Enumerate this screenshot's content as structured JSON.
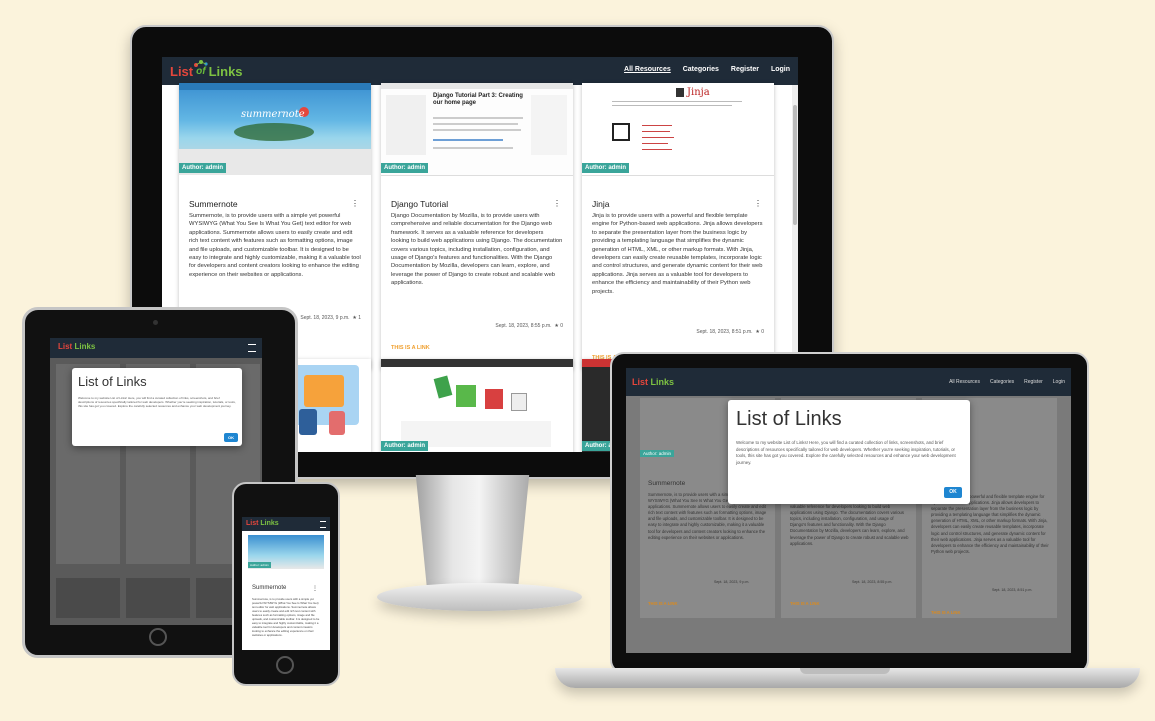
{
  "app": {
    "logo": {
      "list": "List",
      "of": "of",
      "links": "Links"
    },
    "nav": [
      "All Resources",
      "Categories",
      "Register",
      "Login"
    ]
  },
  "cards": [
    {
      "title": "Summernote",
      "badge": "Author: admin",
      "thumb_caption": "summernote",
      "description": "Summernote, is to provide users with a simple yet powerful WYSIWYG (What You See Is What You Get) text editor for web applications. Summernote allows users to easily create and edit rich text content with features such as formatting options, image and file uploads, and customizable toolbar. It is designed to be easy to integrate and highly customizable, making it a valuable tool for developers and content creators looking to enhance the editing experience on their websites or applications.",
      "date": "Sept. 18, 2023, 9 p.m.",
      "likes": "1",
      "link": ""
    },
    {
      "title": "Django Tutorial",
      "badge": "Author: admin",
      "thumb_caption": "Django Tutorial Part 3: Creating our home page",
      "description": "Django Documentation by Mozilla, is to provide users with comprehensive and reliable documentation for the Django web framework. It serves as a valuable reference for developers looking to build web applications using Django. The documentation covers various topics, including installation, configuration, and usage of Django's features and functionalities. With the Django Documentation by Mozilla, developers can learn, explore, and leverage the power of Django to create robust and scalable web applications.",
      "date": "Sept. 18, 2023, 8:55 p.m.",
      "likes": "0",
      "link": "THIS IS A LINK"
    },
    {
      "title": "Jinja",
      "badge": "Author: admin",
      "thumb_caption": "Jinja",
      "description": "Jinja is to provide users with a powerful and flexible template engine for Python-based web applications. Jinja allows developers to separate the presentation layer from the business logic by providing a templating language that simplifies the dynamic generation of HTML, XML, or other markup formats. With Jinja, developers can easily create reusable templates, incorporate logic and control structures, and generate dynamic content for their web applications. Jinja serves as a valuable tool for developers to enhance the efficiency and maintainability of their Python web projects.",
      "date": "Sept. 18, 2023, 8:51 p.m.",
      "likes": "0",
      "link": "THIS IS A LINK"
    }
  ],
  "row2_badge": "Author: admin",
  "modal": {
    "title": "List of Links",
    "text": "Welcome to my website List of Links! Here, you will find a curated collection of links, screenshots, and brief descriptions of resources specifically tailored for web developers. Whether you're seeking inspiration, tutorials, or tools, this site has got you covered. Explore the carefully selected resources and enhance your web development journey.",
    "ok": "OK"
  },
  "laptop": {
    "card1_title": "Summernote",
    "card1_desc": "Summernote, is to provide users with a simple yet powerful WYSIWYG (What You See Is What You Get) text editor for web applications. Summernote allows users to easily create and edit rich text content with features such as formatting options, image and file uploads, and customizable toolbar. It is designed to be easy to integrate and highly customizable, making it a valuable tool for developers and content creators looking to enhance the editing experience on their websites or applications.",
    "card1_date": "Sept. 18, 2023, 9 p.m.",
    "card2_desc": "documentation for the Django web framework. It serves as a valuable reference for developers looking to build web applications using Django. The documentation covers various topics, including installation, configuration, and usage of Django's features and functionality. With the Django Documentation by Mozilla, developers can learn, explore, and leverage the power of Django to create robust and scalable web applications.",
    "card2_date": "Sept. 18, 2023, 8:55 p.m.",
    "card3_desc": "...ovide users with a powerful and flexible template engine for Python-based web applications. Jinja allows developers to separate the presentation layer from the business logic by providing a templating language that simplifies the dynamic generation of HTML, XML, or other markup formats. With Jinja, developers can easily create reusable templates, incorporate logic and control structures, and generate dynamic content for their web applications. Jinja serves as a valuable tool for developers to enhance the efficiency and maintainability of their Python web projects.",
    "card3_date": "Sept. 18, 2023, 8:51 p.m.",
    "link": "THIS IS A LINK"
  },
  "phone": {
    "card_title": "Summernote",
    "card_desc": "Summernote, is to provide users with a simple yet powerful WYSIWYG (What You See Is What You Get) text editor for web applications. Summernote allows users to easily create and edit rich text content with features such as formatting options, image and file uploads, and customizable toolbar. It is designed to be easy to integrate and highly customizable, making it a valuable tool for developers and content creators looking to enhance the editing experience on their websites or applications."
  },
  "colors": {
    "navbar": "#1f2b38",
    "badge": "#3aa59a",
    "link": "#f0a030",
    "ok_button": "#1f86d1",
    "background": "#fbf3dc"
  }
}
